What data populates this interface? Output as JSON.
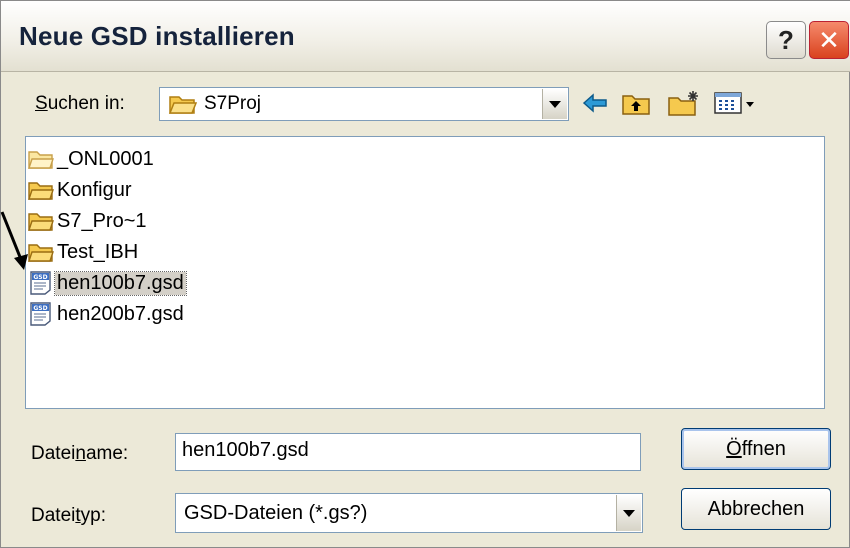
{
  "dialog": {
    "title": "Neue GSD installieren",
    "help_label": "?",
    "close_label": "✕"
  },
  "look_in": {
    "label_pre": "",
    "label_u": "S",
    "label_post": "uchen in:",
    "value": "S7Proj"
  },
  "files": [
    {
      "name": "_ONL0001",
      "type": "folder-open-icon"
    },
    {
      "name": "Konfigur",
      "type": "folder-icon"
    },
    {
      "name": "S7_Pro~1",
      "type": "folder-icon"
    },
    {
      "name": "Test_IBH",
      "type": "folder-icon"
    },
    {
      "name": "hen100b7.gsd",
      "type": "gsd-file-icon",
      "selected": true
    },
    {
      "name": "hen200b7.gsd",
      "type": "gsd-file-icon"
    }
  ],
  "filename": {
    "label_pre": "Datei",
    "label_u": "n",
    "label_post": "ame:",
    "value": "hen100b7.gsd"
  },
  "filetype": {
    "label_pre": "Datei",
    "label_u": "t",
    "label_post": "yp:",
    "value": "GSD-Dateien (*.gs?)"
  },
  "buttons": {
    "open_pre": "",
    "open_u": "Ö",
    "open_post": "ffnen",
    "cancel": "Abbrechen"
  },
  "colors": {
    "folder": "#f5c94e",
    "dialog_bg": "#ece9d8",
    "close": "#d9421e"
  }
}
